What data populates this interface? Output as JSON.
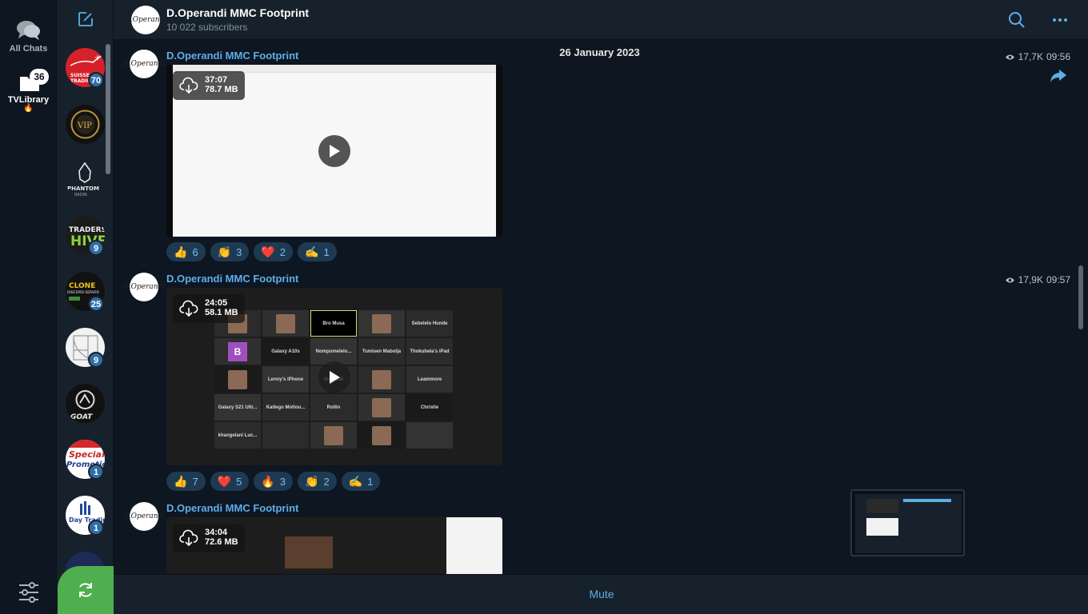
{
  "folders": {
    "all_chats": {
      "label": "All Chats",
      "icon": "chat-bubbles-icon"
    },
    "tv_library": {
      "label": "TVLibrary",
      "emoji": "🔥",
      "badge": "36",
      "icon": "folder-icon"
    }
  },
  "chatlist": {
    "items": [
      {
        "name": "suisse-trading",
        "badge": "70",
        "text": "SUISSE TRADIN"
      },
      {
        "name": "vip",
        "badge": "",
        "text": "VIP"
      },
      {
        "name": "phantom-radin",
        "badge": "",
        "text": "PHANTOM RADIN"
      },
      {
        "name": "traders-hive",
        "badge": "9",
        "text": "TRADERS HIVE"
      },
      {
        "name": "clone-discord-server",
        "badge": "25",
        "text": "CLONE DISCORD SERVER"
      },
      {
        "name": "golden-ratio",
        "badge": "9",
        "text": ""
      },
      {
        "name": "goat",
        "badge": "",
        "text": "GOAT"
      },
      {
        "name": "special-promotion",
        "badge": "1",
        "text": "Special Promotion"
      },
      {
        "name": "day-trading-institute",
        "badge": "1",
        "text": "Day Trading"
      }
    ]
  },
  "header": {
    "title": "D.Operandi MMC Footprint",
    "subscribers": "10 022 subscribers",
    "avatar_text": "D.Operandi"
  },
  "feed": {
    "date": "26 January 2023",
    "posts": [
      {
        "author": "D.Operandi MMC Footprint",
        "views": "17,7K",
        "time": "09:56",
        "duration": "37:07",
        "size": "78.7 MB",
        "reactions": [
          {
            "emoji": "👍",
            "count": "6"
          },
          {
            "emoji": "👏",
            "count": "3"
          },
          {
            "emoji": "❤️",
            "count": "2"
          },
          {
            "emoji": "✍️",
            "count": "1"
          }
        ]
      },
      {
        "author": "D.Operandi MMC Footprint",
        "views": "17,9K",
        "time": "09:57",
        "duration": "24:05",
        "size": "58.1 MB",
        "reactions": [
          {
            "emoji": "👍",
            "count": "7"
          },
          {
            "emoji": "❤️",
            "count": "5"
          },
          {
            "emoji": "🔥",
            "count": "3"
          },
          {
            "emoji": "👏",
            "count": "2"
          },
          {
            "emoji": "✍️",
            "count": "1"
          }
        ]
      },
      {
        "author": "D.Operandi MMC Footprint",
        "views": "",
        "time": "",
        "duration": "34:04",
        "size": "72.6 MB",
        "reactions": []
      }
    ]
  },
  "grid_names": [
    "Bro Musa",
    "Sebelelo Hunde",
    "Galaxy A10s",
    "Nompumelelo...",
    "Tumisen Mabolja",
    "Thokubela's iPad",
    "Lenny's iPhone",
    "Vusesuk",
    "Leammore",
    "Galaxy S21 Ultr...",
    "Katlego Motlou...",
    "Rollin",
    "Christie",
    "khangelani Luc..."
  ],
  "bottombar": {
    "mute_label": "Mute"
  },
  "colors": {
    "accent": "#5eaee8",
    "refresh": "#4fae4e",
    "badge": "#2f6ea5",
    "bg": "#0e1621",
    "panel": "#17212b"
  }
}
